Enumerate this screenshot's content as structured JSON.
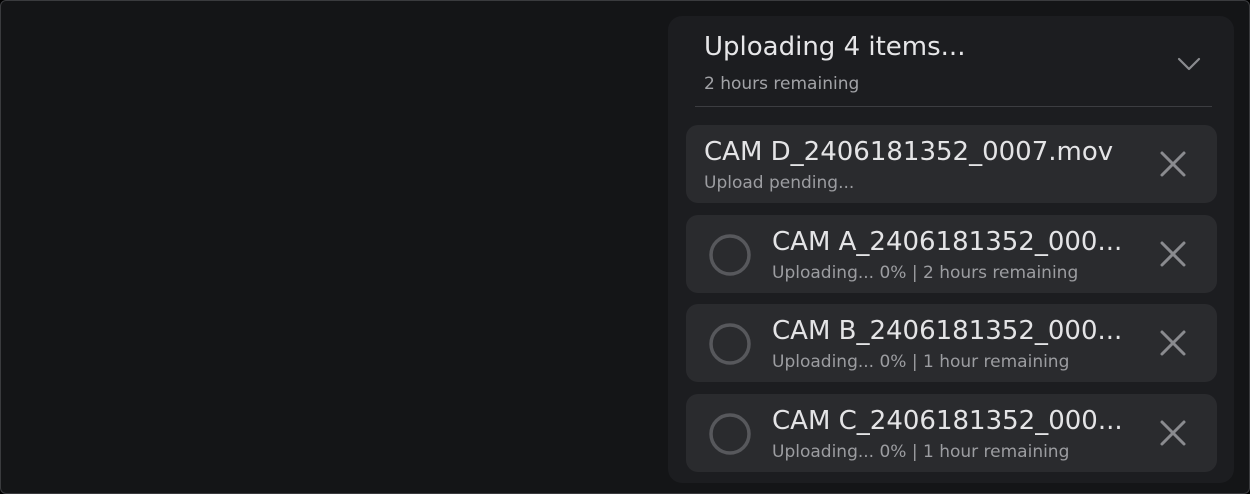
{
  "panel": {
    "title": "Uploading 4 items...",
    "subtitle": "2 hours remaining"
  },
  "items": [
    {
      "name": "CAM D_2406181352_0007.mov",
      "status": "Upload pending..."
    },
    {
      "name": "CAM A_2406181352_000...",
      "status": "Uploading... 0% | 2 hours remaining",
      "progress": 0
    },
    {
      "name": "CAM B_2406181352_000...",
      "status": "Uploading... 0% | 1 hour remaining",
      "progress": 0
    },
    {
      "name": "CAM C_2406181352_000...",
      "status": "Uploading... 0% | 1 hour remaining",
      "progress": 0
    }
  ],
  "colors": {
    "panel_bg": "#1c1d20",
    "item_bg": "#2a2b2e",
    "text_primary": "#e4e4e6",
    "text_secondary": "#9c9da1",
    "icon": "#8a8b8f"
  }
}
